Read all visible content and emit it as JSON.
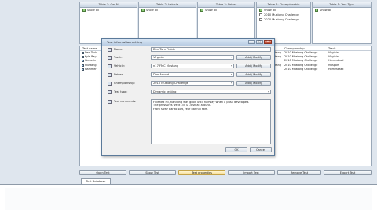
{
  "filter_panels": [
    {
      "header": "Table 1: Car N",
      "rows": [
        "Show all"
      ]
    },
    {
      "header": "Table 2: Vehicle",
      "rows": [
        "Show all"
      ]
    },
    {
      "header": "Table 3: Driver",
      "rows": [
        "Show all"
      ]
    },
    {
      "header": "Table 4: Championship",
      "rows": [
        "Show all",
        "2010 Mustang Challenge",
        "2020 Mustang Challenge"
      ]
    },
    {
      "header": "Table 5: Test Type",
      "rows": [
        "Show all"
      ]
    }
  ],
  "results": {
    "left_columns": [
      "Test name"
    ],
    "left_rows": [
      "Den Tech",
      "Kyle Ray",
      "Hamelin",
      "Mustang",
      "Hammer"
    ],
    "right_columns": [
      "Championship",
      "Track"
    ],
    "right_rows": [
      {
        "championship": "2010 Mustang Challenge",
        "track": "Virginia"
      },
      {
        "championship": "2010 Mustang Challenge",
        "track": "Virginia"
      },
      {
        "championship": "2010 Mustang Challenge",
        "track": "Homestead"
      },
      {
        "championship": "2010 Mustang Challenge",
        "track": "Mosport"
      },
      {
        "championship": "2010 Mustang Challenge",
        "track": "Homestead"
      }
    ],
    "mid_rows": [
      "FMC Mustang",
      "FMC Mustang",
      "",
      "FMC Mustang",
      ""
    ]
  },
  "buttons": [
    "Open Test",
    "Show Test",
    "Test properties",
    "Import Test",
    "Remove Test",
    "Export Test"
  ],
  "active_button_index": 2,
  "dialog": {
    "title": "Test information setting",
    "fields": [
      {
        "label": "Name:",
        "value": "Den Turn Fluids",
        "type": "text"
      },
      {
        "label": "Track:",
        "value": "Virginia",
        "type": "combo",
        "button": "Add / Modify"
      },
      {
        "label": "Vehicle:",
        "value": "n17 FMC Mustang",
        "type": "combo",
        "button": "Add / Modify"
      },
      {
        "label": "Driver:",
        "value": "Den Arnold",
        "type": "combo",
        "button": "Add / Modify"
      },
      {
        "label": "Championship:",
        "value": "2010 Mustang Challenge",
        "type": "combo",
        "button": "Add / Modify"
      },
      {
        "label": "Test type:",
        "value": "Dynamic testing",
        "type": "combo"
      }
    ],
    "notes_label": "Test comments:",
    "notes_lines": [
      "Finished F3, handling was good until halfway when a push developed.",
      "The pressures went .35 & .5ish all around.",
      "Front sway bar to soft, rear bar full stiff."
    ],
    "ok_label": "OK",
    "cancel_label": "Cancel",
    "caption_min": "–",
    "caption_max": "□",
    "caption_close": "✕"
  },
  "bottom_tab": "Test Database"
}
